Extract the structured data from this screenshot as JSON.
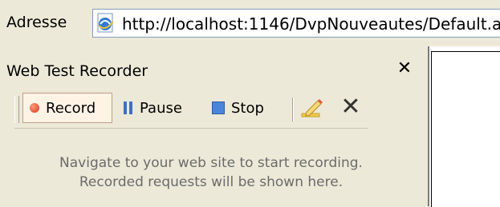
{
  "address_bar": {
    "label": "Adresse",
    "url": "http://localhost:1146/DvpNouveautes/Default.as",
    "icon": "ie-page-icon"
  },
  "recorder_panel": {
    "title": "Web Test Recorder",
    "close_label": "✕",
    "toolbar": {
      "record_label": "Record",
      "pause_label": "Pause",
      "stop_label": "Stop",
      "edit_icon": "edit-icon",
      "delete_icon": "delete-icon"
    },
    "message_line1": "Navigate to your web site to start recording.",
    "message_line2": "Recorded requests will be shown here."
  },
  "colors": {
    "record_accent": "#d23a1a",
    "pause_accent": "#3d6fc7",
    "stop_accent": "#4a86d8",
    "panel_bg": "#ece9d8"
  }
}
